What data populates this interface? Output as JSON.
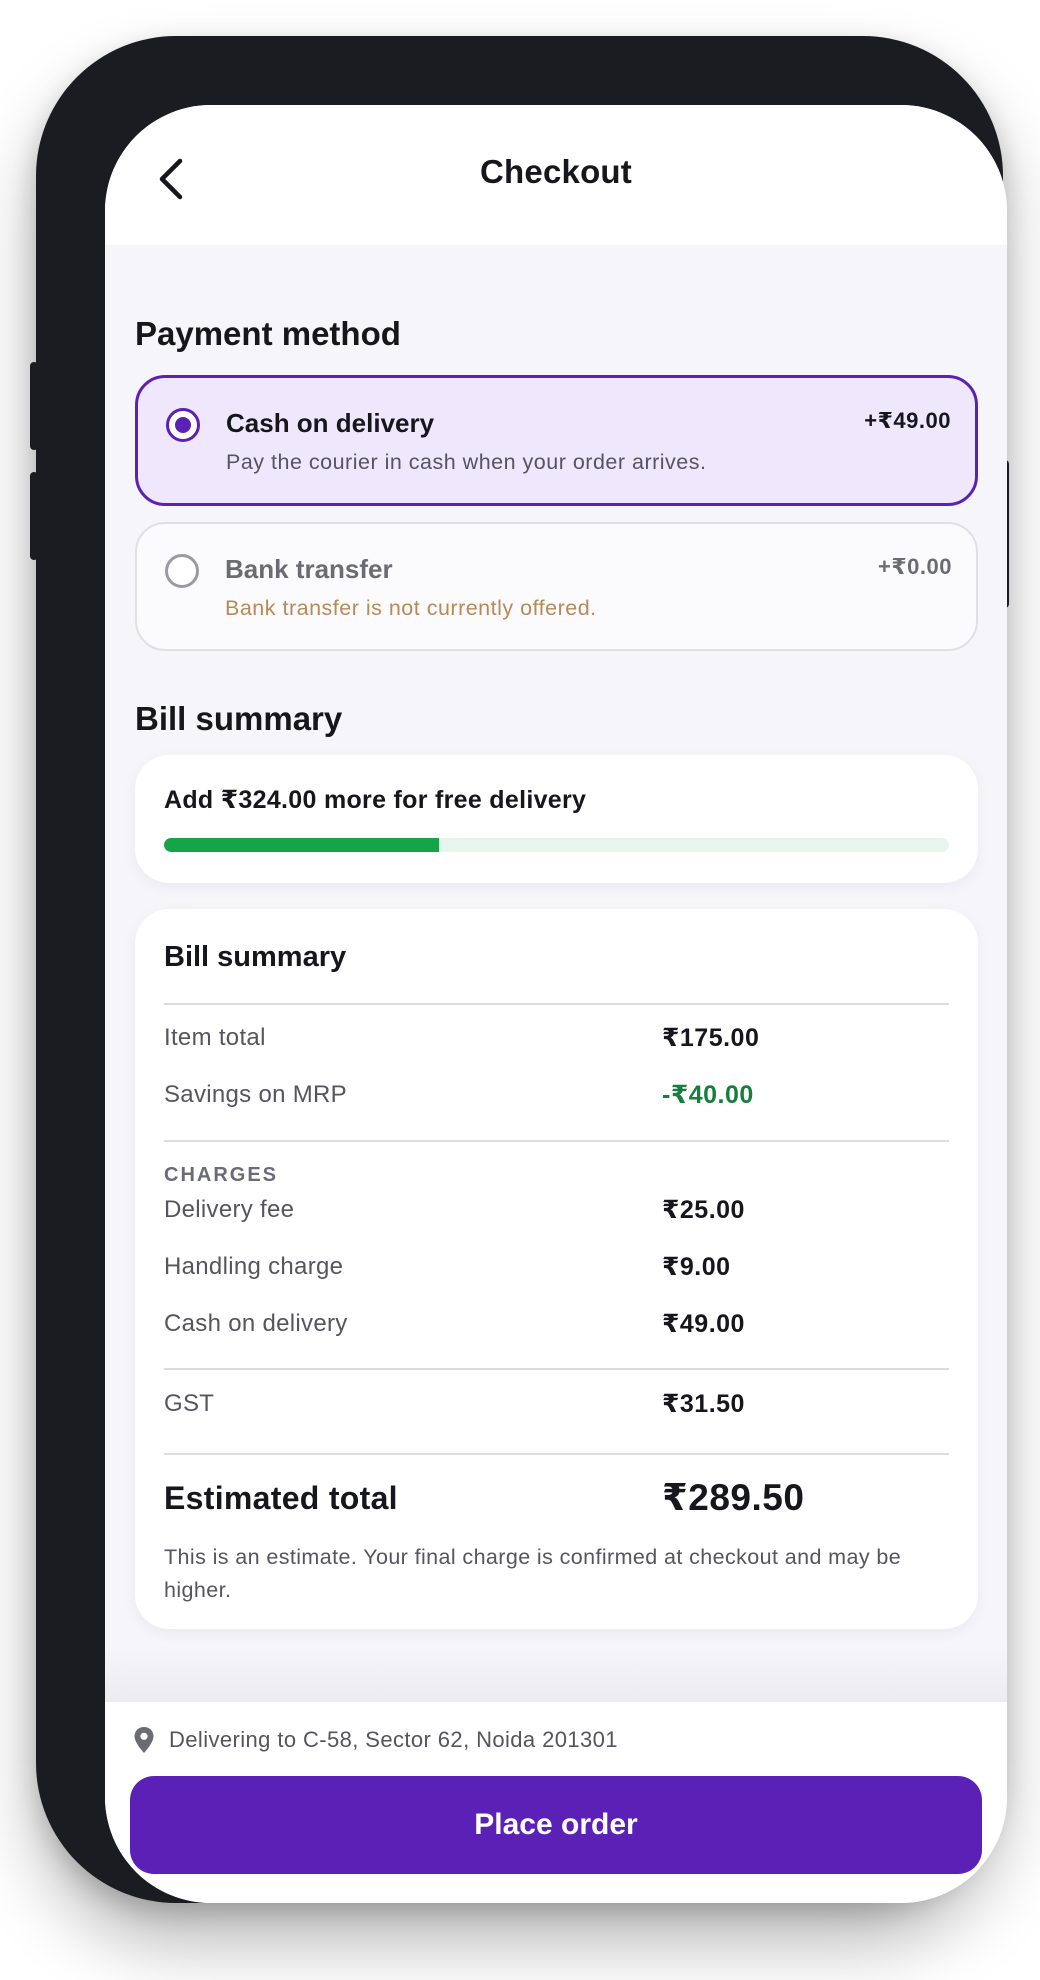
{
  "header": {
    "title": "Checkout",
    "back_icon": "chevron-left-icon"
  },
  "payment": {
    "section_title": "Payment method",
    "options": [
      {
        "name": "Cash on delivery",
        "description": "Pay the courier in cash when your order arrives.",
        "price": "+₹49.00",
        "selected": true,
        "enabled": true
      },
      {
        "name": "Bank transfer",
        "description": "Bank transfer is not currently offered.",
        "price": "+₹0.00",
        "selected": false,
        "enabled": false
      }
    ]
  },
  "free_delivery": {
    "section_title": "Bill summary",
    "message": "Add ₹324.00 more for free delivery",
    "progress_fraction": 0.35
  },
  "bill": {
    "title": "Bill summary",
    "item_total_label": "Item total",
    "item_total_value": "₹175.00",
    "savings_label": "Savings on MRP",
    "savings_value": "-₹40.00",
    "charges_heading": "CHARGES",
    "delivery_fee_label": "Delivery fee",
    "delivery_fee_value": "₹25.00",
    "handling_label": "Handling charge",
    "handling_value": "₹9.00",
    "cod_label": "Cash on delivery",
    "cod_value": "₹49.00",
    "gst_label": "GST",
    "gst_value": "₹31.50",
    "total_label": "Estimated total",
    "total_value": "₹289.50",
    "note": "This is an estimate. Your final charge is confirmed at checkout and may be higher."
  },
  "footer": {
    "address_icon": "location-pin-icon",
    "address": "Delivering to C-58, Sector 62, Noida 201301",
    "cta_label": "Place order"
  },
  "colors": {
    "accent": "#5b21b6",
    "selected_bg": "#efe7fc",
    "progress": "#16a34a",
    "savings": "#15803d",
    "unavailable_text": "#b68a58"
  }
}
